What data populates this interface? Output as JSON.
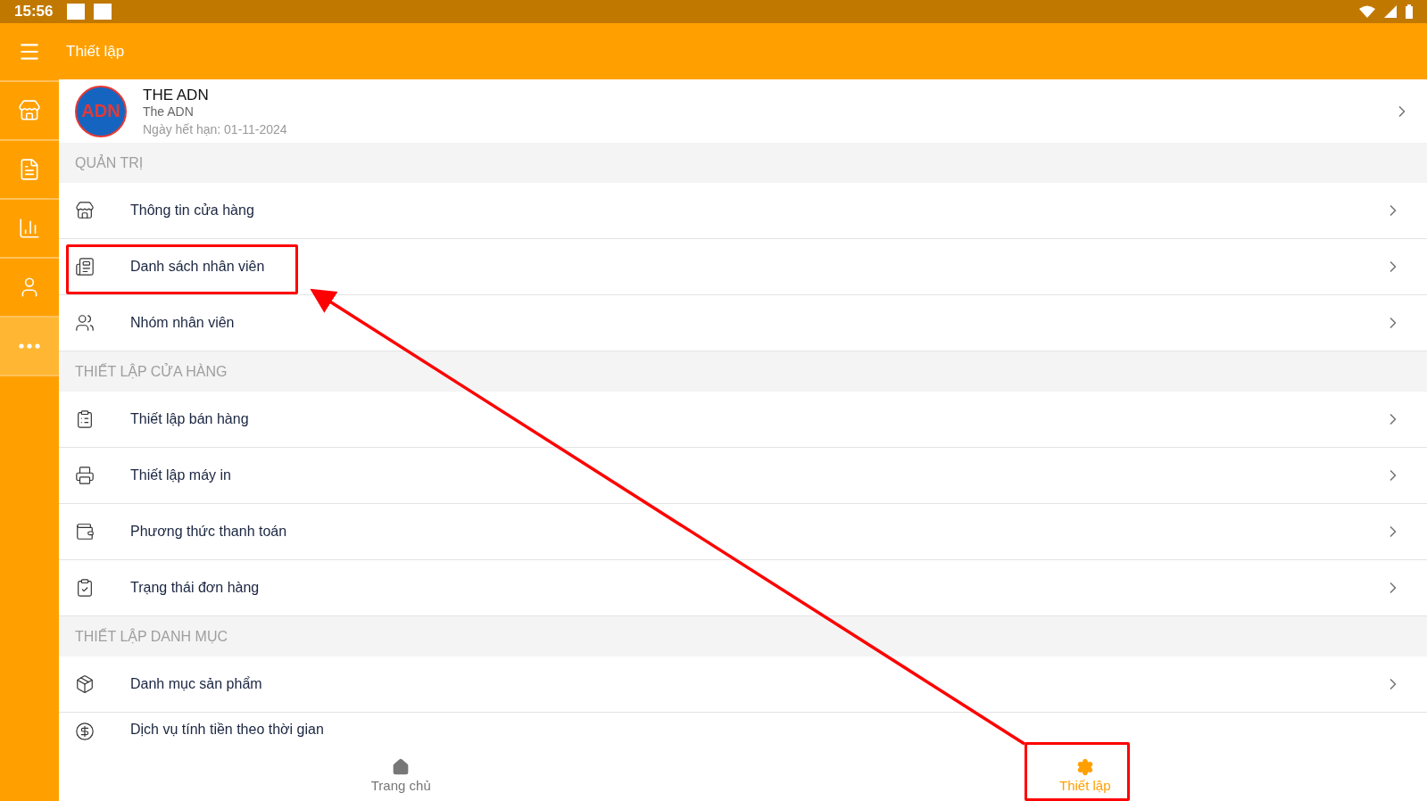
{
  "status_bar": {
    "time": "15:56"
  },
  "sidebar": {
    "items": [
      {
        "kind": "store",
        "selected": false
      },
      {
        "kind": "invoice",
        "selected": false
      },
      {
        "kind": "chart",
        "selected": false
      },
      {
        "kind": "user",
        "selected": false
      },
      {
        "kind": "more",
        "selected": true
      }
    ]
  },
  "header": {
    "title": "Thiết lập"
  },
  "profile": {
    "logo_text": "ADN",
    "name": "THE ADN",
    "subtitle": "The ADN",
    "expiry": "Ngày hết hạn: 01-11-2024"
  },
  "sections": [
    {
      "title": "QUẢN TRỊ",
      "items": [
        {
          "label": "Thông tin cửa hàng",
          "kind": "store",
          "highlighted": false
        },
        {
          "label": "Danh sách nhân viên",
          "kind": "list",
          "highlighted": true
        },
        {
          "label": "Nhóm nhân viên",
          "kind": "group",
          "highlighted": false
        }
      ]
    },
    {
      "title": "THIẾT LẬP CỬA HÀNG",
      "items": [
        {
          "label": "Thiết lập bán hàng",
          "kind": "clipboard",
          "highlighted": false
        },
        {
          "label": "Thiết lập máy in",
          "kind": "printer",
          "highlighted": false
        },
        {
          "label": "Phương thức thanh toán",
          "kind": "wallet",
          "highlighted": false
        },
        {
          "label": "Trạng thái đơn hàng",
          "kind": "clipcheck",
          "highlighted": false
        }
      ]
    },
    {
      "title": "THIẾT LẬP DANH MỤC",
      "items": [
        {
          "label": "Danh mục sản phẩm",
          "kind": "box",
          "highlighted": false
        },
        {
          "label": "Dịch vụ tính tiền theo thời gian",
          "kind": "coin",
          "highlighted": false
        }
      ]
    }
  ],
  "bottom_nav": [
    {
      "label": "Trang chủ",
      "kind": "home",
      "selected": false,
      "highlighted": false
    },
    {
      "label": "Thiết lập",
      "kind": "gear",
      "selected": true,
      "highlighted": true
    }
  ]
}
